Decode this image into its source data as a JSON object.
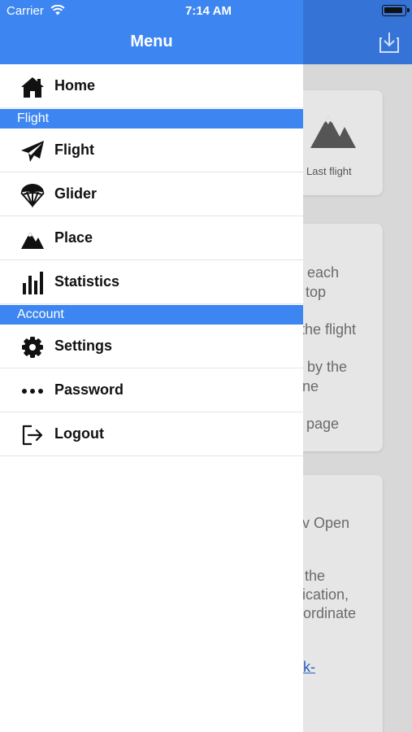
{
  "status_bar": {
    "carrier": "Carrier",
    "time": "7:14 AM"
  },
  "background": {
    "card_caption": "Last flight",
    "fragments": [
      "f each",
      "top",
      "the flight",
      "by the",
      "ne",
      "page",
      "v Open",
      "the",
      "ication,",
      "ordinate",
      "k-"
    ]
  },
  "drawer": {
    "title": "Menu",
    "home": {
      "label": "Home",
      "icon": "home-icon"
    },
    "sections": {
      "flight": {
        "title": "Flight"
      },
      "account": {
        "title": "Account"
      }
    },
    "flight_items": [
      {
        "label": "Flight",
        "icon": "paper-plane-icon"
      },
      {
        "label": "Glider",
        "icon": "parachute-icon"
      },
      {
        "label": "Place",
        "icon": "mountain-icon"
      },
      {
        "label": "Statistics",
        "icon": "bar-chart-icon"
      }
    ],
    "account_items": [
      {
        "label": "Settings",
        "icon": "gear-icon"
      },
      {
        "label": "Password",
        "icon": "dots-icon"
      },
      {
        "label": "Logout",
        "icon": "logout-icon"
      }
    ]
  },
  "colors": {
    "accent": "#3d86f1",
    "header_dimmed": "#3574d6",
    "overlay_bg": "#d8d8d8"
  }
}
